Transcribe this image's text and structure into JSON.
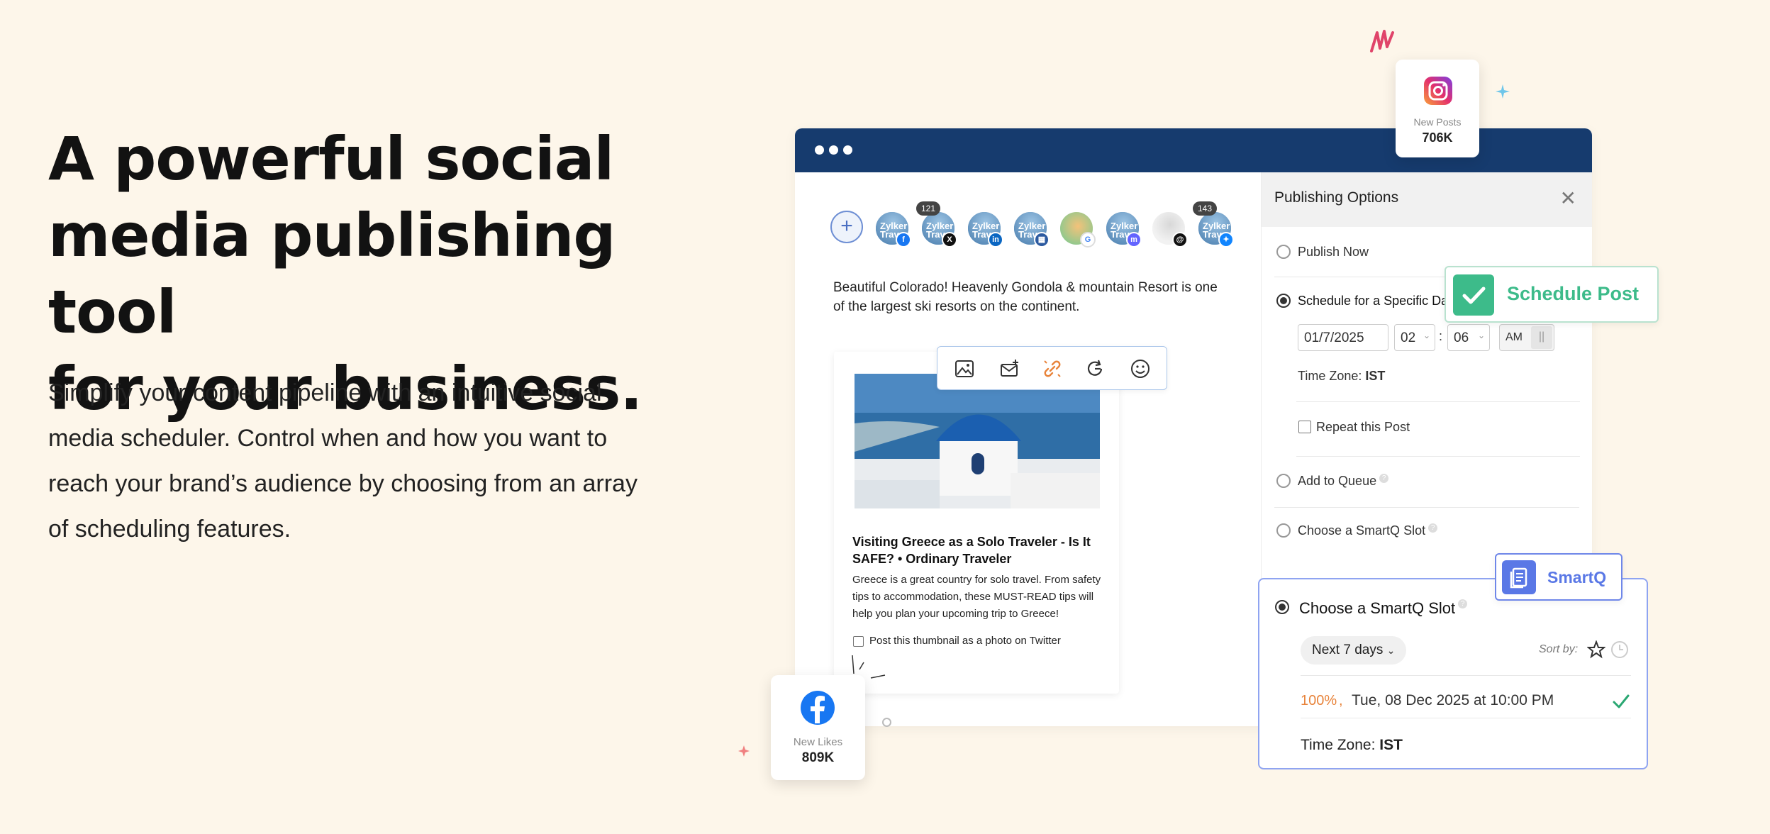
{
  "hero": {
    "title_line1": "A powerful social",
    "title_line2": "media publishing tool",
    "title_line3": "for your business.",
    "subtitle_line1": "Simplify your content pipeline with an intuitive social",
    "subtitle_line2": "media scheduler. Control when and how you want to",
    "subtitle_line3": "reach your brand’s audience by choosing from an array",
    "subtitle_line4": "of scheduling features."
  },
  "colors": {
    "background": "#fdf6ea",
    "topbar": "#163b6e",
    "accent_green": "#3dbb8a",
    "accent_blue": "#5a78e6",
    "orange": "#e8833a"
  },
  "instagram_card": {
    "label": "New Posts",
    "value": "706K"
  },
  "facebook_card": {
    "label": "New Likes",
    "value": "809K"
  },
  "composer": {
    "avatar_text": "Zylker Trav",
    "count_1": "121",
    "count_2": "143",
    "post_text": "Beautiful Colorado! Heavenly Gondola & mountain Resort is one of the largest ski resorts on the continent.",
    "link_title": "Visiting Greece as a Solo Traveler - Is It SAFE? • Ordinary Traveler",
    "link_desc": "Greece is a great country for solo travel. From safety tips to accommodation, these MUST-READ tips will help you plan your upcoming trip to Greece!",
    "thumbnail_option": "Post this thumbnail as a photo on Twitter"
  },
  "publishing": {
    "title": "Publishing Options",
    "publish_now": "Publish Now",
    "schedule_specific": "Schedule for a Specific Date",
    "date": "01/7/2025",
    "hour": "02",
    "minute": "06",
    "ampm": "AM",
    "timezone_label": "Time Zone:",
    "timezone_value": "IST",
    "repeat": "Repeat this Post",
    "add_queue": "Add to Queue",
    "smartq_slot": "Choose a SmartQ Slot"
  },
  "schedule_badge": {
    "label": "Schedule Post"
  },
  "smartq_badge": {
    "label": "SmartQ"
  },
  "smartq_panel": {
    "title": "Choose a SmartQ Slot",
    "range": "Next 7 days",
    "sort_by": "Sort by:",
    "percent": "100%",
    "comma": ",",
    "slot": "Tue, 08 Dec 2025 at 10:00 PM",
    "timezone_label": "Time Zone:",
    "timezone_value": "IST"
  }
}
